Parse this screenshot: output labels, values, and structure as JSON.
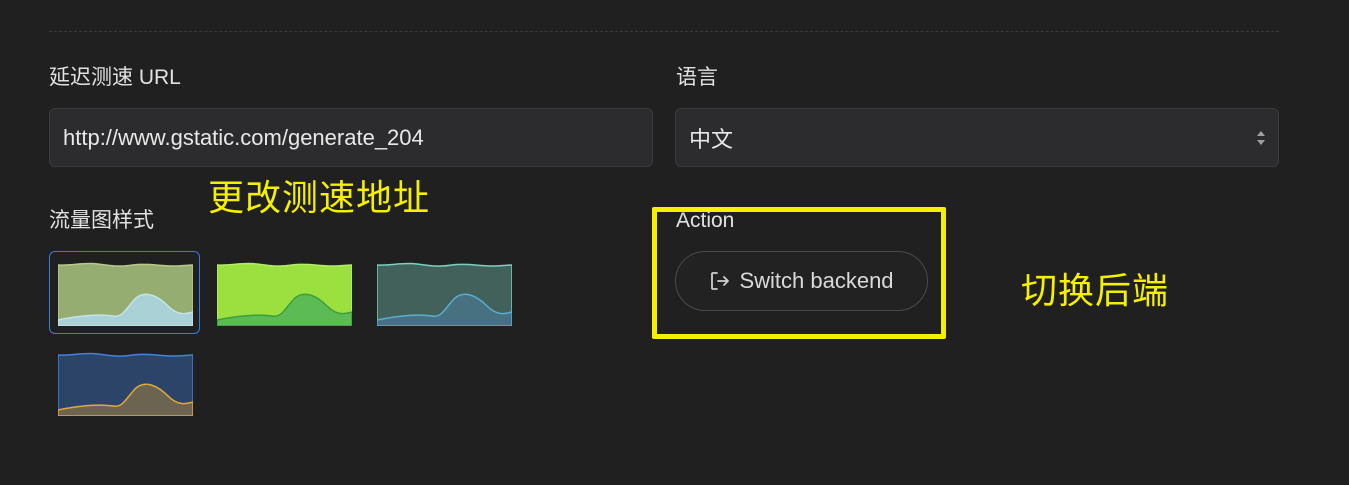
{
  "latency_test": {
    "label": "延迟测速 URL",
    "value": "http://www.gstatic.com/generate_204"
  },
  "language": {
    "label": "语言",
    "selected": "中文"
  },
  "traffic_chart_style": {
    "label": "流量图样式",
    "options": [
      {
        "id": "style-1",
        "selected": true,
        "top_fill": "#95ad70",
        "top_line": "#b8c98e",
        "bottom_fill": "#a9d1d6",
        "bottom_line": "#c7e3e6"
      },
      {
        "id": "style-2",
        "selected": false,
        "top_fill": "#9be03f",
        "top_line": "#b4ec63",
        "bottom_fill": "#5cbb55",
        "bottom_line": "#3e9e3c"
      },
      {
        "id": "style-3",
        "selected": false,
        "top_fill": "#41615a",
        "top_line": "#7ad1c0",
        "bottom_fill": "#477080",
        "bottom_line": "#5aaed0"
      },
      {
        "id": "style-4",
        "selected": false,
        "top_fill": "#2b4468",
        "top_line": "#3f82e0",
        "bottom_fill": "#6b6450",
        "bottom_line": "#e3a93a"
      }
    ]
  },
  "action": {
    "label": "Action",
    "switch_backend_label": "Switch backend",
    "icon": "sign-out-icon"
  },
  "annotations": {
    "change_test_url": "更改测速地址",
    "switch_backend": "切换后端",
    "highlight_color": "#f5f000"
  }
}
